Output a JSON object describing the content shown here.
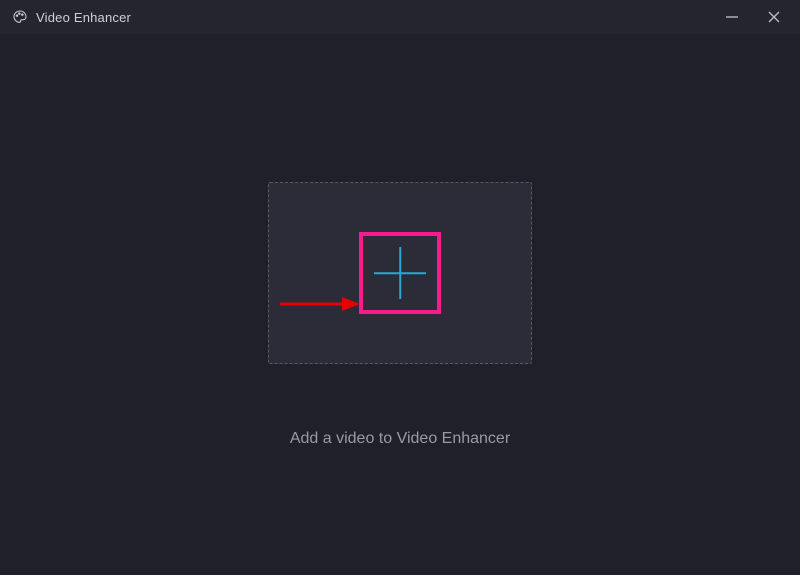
{
  "titlebar": {
    "app_name": "Video Enhancer"
  },
  "main": {
    "drop_caption": "Add a video to Video Enhancer"
  },
  "icons": {
    "app": "palette-icon",
    "minimize": "minimize-icon",
    "close": "close-icon",
    "add": "plus-icon"
  },
  "annotation": {
    "arrow_color": "#e60000",
    "highlight_color": "#f81b8c"
  }
}
